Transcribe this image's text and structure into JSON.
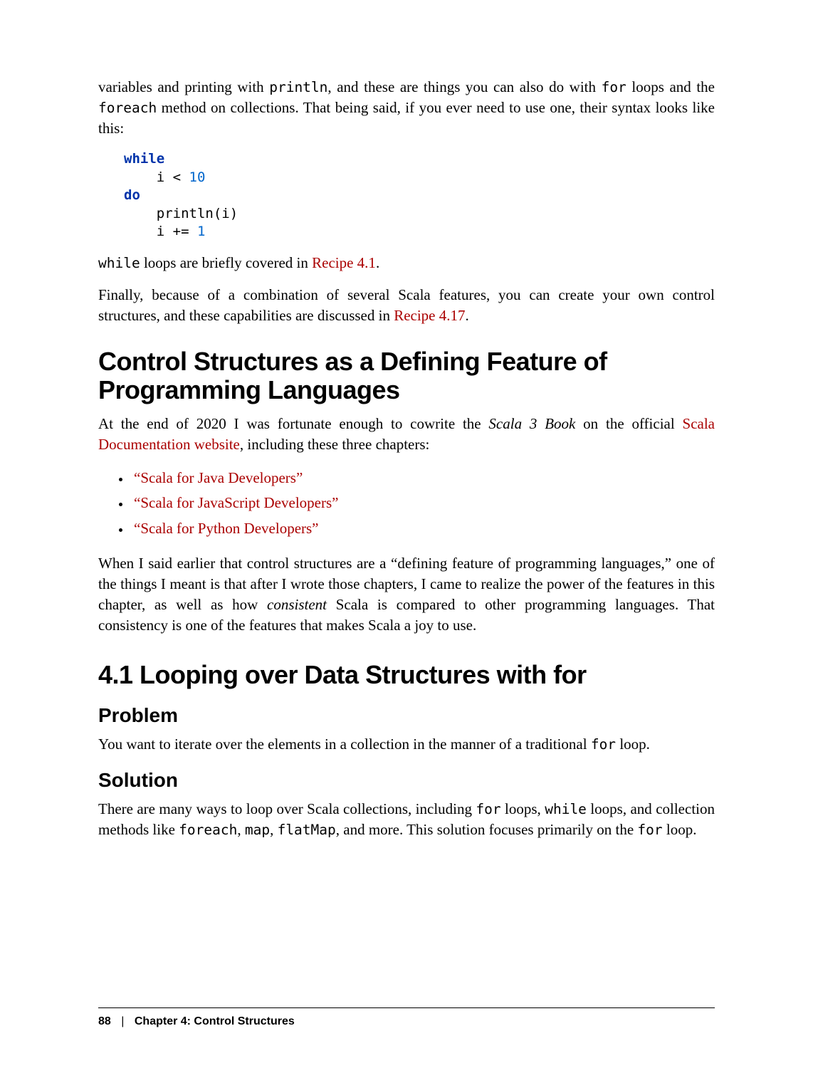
{
  "para1_a": "variables and printing with ",
  "para1_code1": "println",
  "para1_b": ", and these are things you can also do with ",
  "para1_code2": "for",
  "para1_c": " loops and the ",
  "para1_code3": "foreach",
  "para1_d": " method on collections. That being said, if you ever need to use one, their syntax looks like this:",
  "code": {
    "l1_kw": "while",
    "l2_a": "    i ",
    "l2_op": "<",
    "l2_b": " ",
    "l2_num": "10",
    "l3_kw": "do",
    "l4": "    println(i)",
    "l5_a": "    i ",
    "l5_op": "+=",
    "l5_b": " ",
    "l5_num": "1"
  },
  "para2_code": "while",
  "para2_a": " loops are briefly covered in ",
  "para2_link": "Recipe 4.1",
  "para2_b": ".",
  "para3_a": "Finally, because of a combination of several Scala features, you can create your own control structures, and these capabilities are discussed in ",
  "para3_link": "Recipe 4.17",
  "para3_b": ".",
  "h2": "Control Structures as a Defining Feature of Programming Languages",
  "para4_a": "At the end of 2020 I was fortunate enough to cowrite the ",
  "para4_em": "Scala 3 Book",
  "para4_b": " on the official ",
  "para4_link": "Scala Documentation website",
  "para4_c": ", including these three chapters:",
  "bullets": {
    "b1": "“Scala for Java Developers”",
    "b2": "“Scala for JavaScript Developers”",
    "b3": "“Scala for Python Developers”"
  },
  "para5_a": "When I said earlier that control structures are a “defining feature of programming languages,” one of the things I meant is that after I wrote those chapters, I came to realize the power of the features in this chapter, as well as how ",
  "para5_em": "consistent",
  "para5_b": " Scala is compared to other programming languages. That consistency is one of the features that makes Scala a joy to use.",
  "h1": "4.1 Looping over Data Structures with for",
  "h3a": "Problem",
  "para6_a": "You want to iterate over the elements in a collection in the manner of a traditional ",
  "para6_code": "for",
  "para6_b": " loop.",
  "h3b": "Solution",
  "para7_a": "There are many ways to loop over Scala collections, including ",
  "para7_code1": "for",
  "para7_b": " loops, ",
  "para7_code2": "while",
  "para7_c": " loops, and collection methods like ",
  "para7_code3": "foreach",
  "para7_d": ", ",
  "para7_code4": "map",
  "para7_e": ", ",
  "para7_code5": "flatMap",
  "para7_f": ", and more. This solution focuses primarily on the ",
  "para7_code6": "for",
  "para7_g": " loop.",
  "footer": {
    "page": "88",
    "sep": "|",
    "chapter": "Chapter 4: Control Structures"
  }
}
